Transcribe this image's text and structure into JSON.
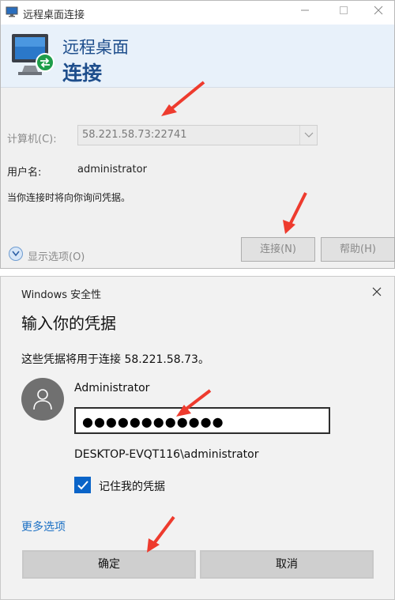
{
  "rdp": {
    "title": "远程桌面连接",
    "banner_line1": "远程桌面",
    "banner_line2": "连接",
    "computer_label": "计算机(C):",
    "computer_value": "58.221.58.73:22741",
    "username_label": "用户名:",
    "username_value": "administrator",
    "hint": "当你连接时将向你询问凭据。",
    "show_options": "显示选项(O)",
    "connect_button": "连接(N)",
    "help_button": "帮助(H)"
  },
  "security": {
    "caption": "Windows 安全性",
    "heading": "输入你的凭据",
    "description": "这些凭据将用于连接 58.221.58.73。",
    "user": "Administrator",
    "password_mask": "●●●●●●●●●●●●",
    "domain_user": "DESKTOP-EVQT116\\administrator",
    "remember_label": "记住我的凭据",
    "remember_checked": true,
    "more_options": "更多选项",
    "ok_button": "确定",
    "cancel_button": "取消"
  },
  "colors": {
    "banner_text": "#1e4e8c",
    "link": "#1a6fc4",
    "checkbox": "#0a64c8",
    "annotation": "#ee3b2e"
  }
}
